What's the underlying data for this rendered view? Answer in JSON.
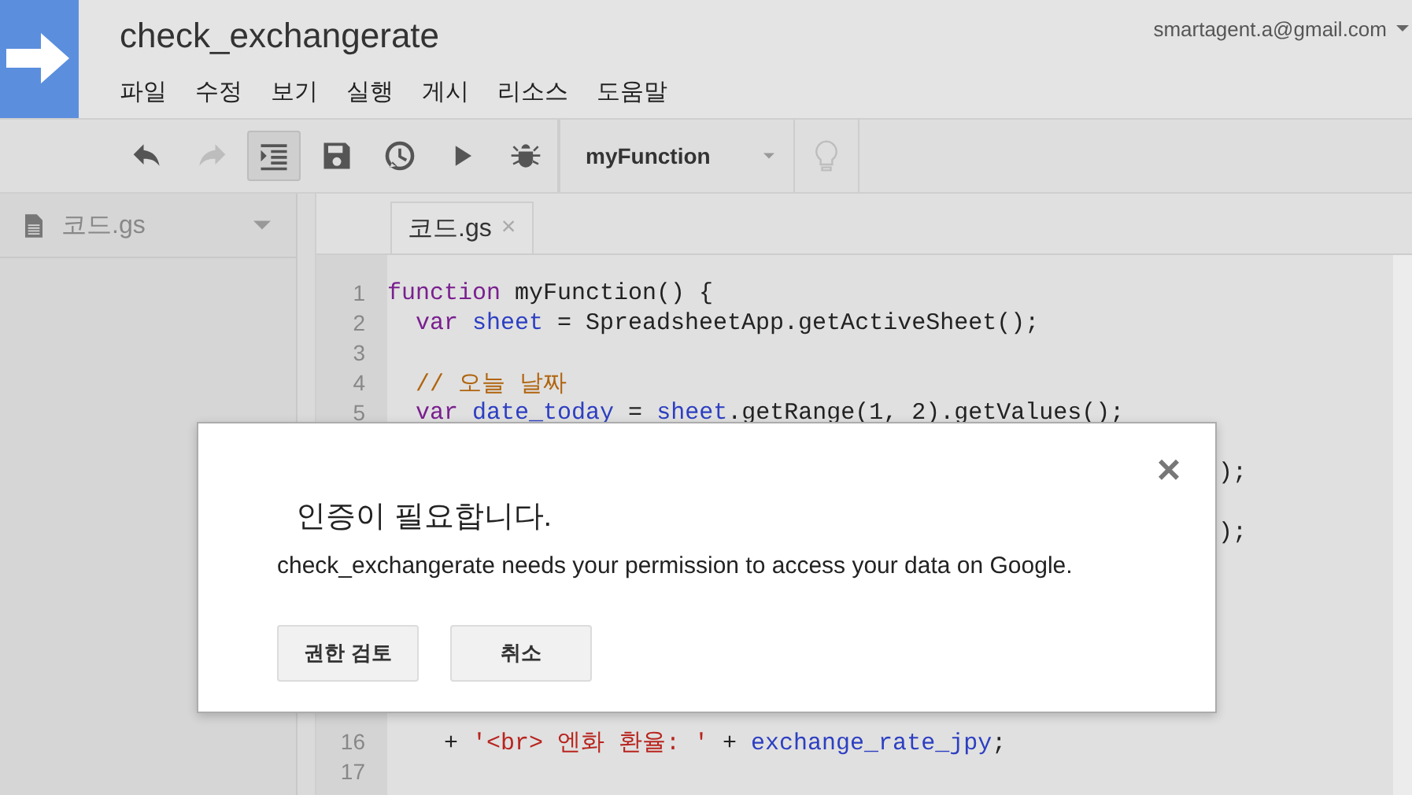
{
  "header": {
    "title": "check_exchangerate",
    "account": "smartagent.a@gmail.com",
    "menu": [
      "파일",
      "수정",
      "보기",
      "실행",
      "게시",
      "리소스",
      "도움말"
    ]
  },
  "toolbar": [
    {
      "kind": "undo",
      "disabled": false,
      "on": false
    },
    {
      "kind": "redo",
      "disabled": true,
      "on": false
    },
    {
      "kind": "indent",
      "disabled": false,
      "on": true
    },
    {
      "kind": "save",
      "disabled": false,
      "on": false
    },
    {
      "kind": "triggers",
      "disabled": false,
      "on": false
    },
    {
      "kind": "run",
      "disabled": false,
      "on": false
    },
    {
      "kind": "debug",
      "disabled": false,
      "on": false
    },
    {
      "kind": "function-select",
      "label": "myFunction"
    },
    {
      "kind": "hint",
      "disabled": true,
      "on": false
    }
  ],
  "sidebar": {
    "files": [
      {
        "name": "코드.gs"
      }
    ]
  },
  "tabs": [
    {
      "label": "코드.gs",
      "close": "×",
      "selected": true
    }
  ],
  "code": [
    {
      "number": "1",
      "tokens": [
        {
          "kind": "keyword",
          "text": "function"
        },
        {
          "kind": "plain",
          "text": " myFunction() {"
        }
      ]
    },
    {
      "number": "2",
      "tokens": [
        {
          "kind": "keyword",
          "text": "  var"
        },
        {
          "kind": "variable",
          "text": " sheet"
        },
        {
          "kind": "plain",
          "text": " = SpreadsheetApp.getActiveSheet();"
        }
      ]
    },
    {
      "number": "3"
    },
    {
      "number": "4",
      "tokens": [
        {
          "kind": "comment",
          "text": "  // 오늘 날짜"
        }
      ]
    },
    {
      "number": "5",
      "tokens": [
        {
          "kind": "keyword",
          "text": "  var"
        },
        {
          "kind": "variable",
          "text": " date_today"
        },
        {
          "kind": "plain",
          "text": " = "
        },
        {
          "kind": "variable",
          "text": "sheet"
        },
        {
          "kind": "plain",
          "text": ".getRange(1, 2).getValues();"
        }
      ]
    },
    {
      "kind": "hidden"
    },
    {
      "kind": "fragment",
      "tokens": [
        {
          "kind": "plain",
          "text": ");"
        }
      ]
    },
    {
      "kind": "hidden"
    },
    {
      "kind": "fragment",
      "tokens": [
        {
          "kind": "plain",
          "text": ");"
        }
      ]
    },
    {
      "kind": "hidden"
    },
    {
      "kind": "hidden"
    },
    {
      "kind": "hidden"
    },
    {
      "kind": "hidden"
    },
    {
      "kind": "hidden"
    },
    {
      "kind": "hidden"
    },
    {
      "number": "16",
      "tokens": [
        {
          "kind": "plain",
          "text": "    + "
        },
        {
          "kind": "string",
          "text": "'<br> 엔화 환율: '"
        },
        {
          "kind": "plain",
          "text": " + "
        },
        {
          "kind": "variable",
          "text": "exchange_rate_jpy"
        },
        {
          "kind": "plain",
          "text": ";"
        }
      ]
    },
    {
      "number": "17"
    }
  ],
  "dialog": {
    "title": "인증이 필요합니다.",
    "message": "check_exchangerate needs your permission to access your data on Google.",
    "close": "×",
    "buttons": [
      "권한 검토",
      "취소"
    ]
  }
}
